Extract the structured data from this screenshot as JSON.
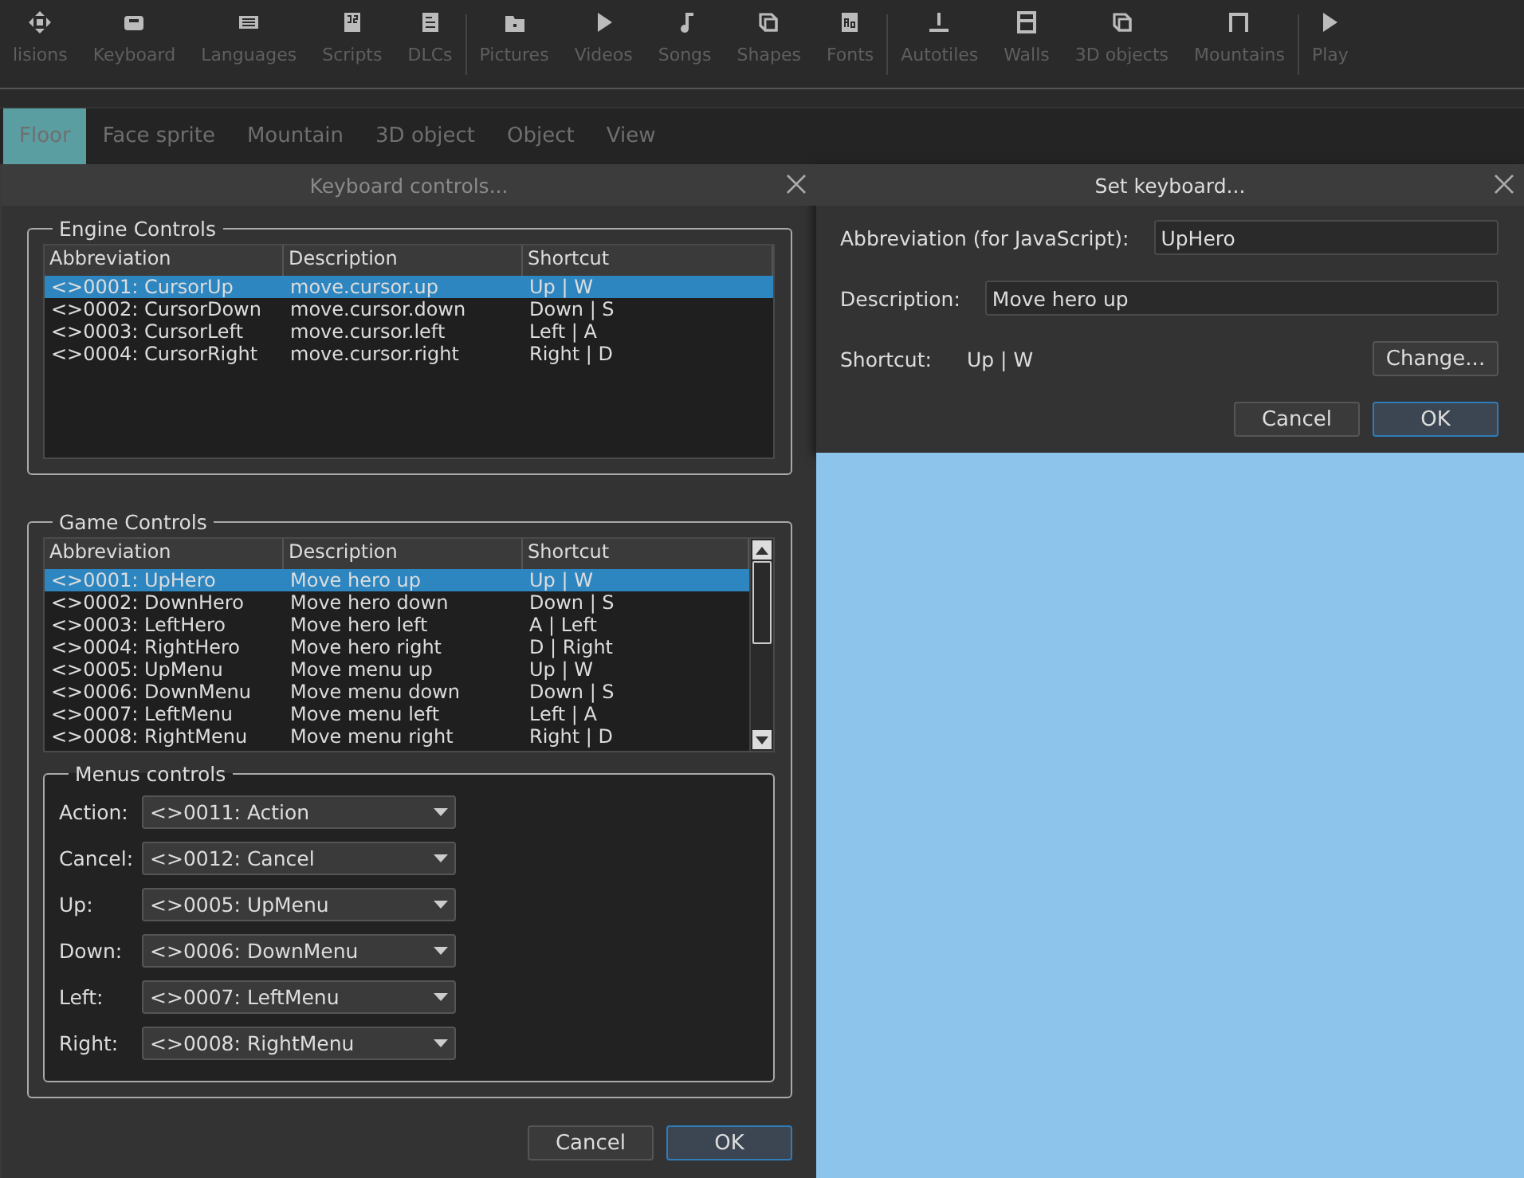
{
  "toolbar": {
    "groups": [
      {
        "items": [
          {
            "label": "lisions",
            "kind": "move"
          },
          {
            "label": "Keyboard",
            "kind": "keyboard"
          },
          {
            "label": "Languages",
            "kind": "flag"
          },
          {
            "label": "Scripts",
            "kind": "script"
          },
          {
            "label": "DLCs",
            "kind": "document"
          }
        ]
      },
      {
        "items": [
          {
            "label": "Pictures",
            "kind": "folder"
          },
          {
            "label": "Videos",
            "kind": "play"
          },
          {
            "label": "Songs",
            "kind": "note"
          },
          {
            "label": "Shapes",
            "kind": "cube"
          },
          {
            "label": "Fonts",
            "kind": "font"
          }
        ]
      },
      {
        "items": [
          {
            "label": "Autotiles",
            "kind": "autotile"
          },
          {
            "label": "Walls",
            "kind": "wall"
          },
          {
            "label": "3D objects",
            "kind": "cube"
          },
          {
            "label": "Mountains",
            "kind": "mountain"
          }
        ]
      },
      {
        "items": [
          {
            "label": "Play",
            "kind": "play"
          }
        ]
      }
    ]
  },
  "tabs": [
    {
      "label": "Floor",
      "selected": true
    },
    {
      "label": "Face sprite",
      "selected": false
    },
    {
      "label": "Mountain",
      "selected": false
    },
    {
      "label": "3D object",
      "selected": false
    },
    {
      "label": "Object",
      "selected": false
    },
    {
      "label": "View",
      "selected": false
    }
  ],
  "keyboard_dialog": {
    "title": "Keyboard controls...",
    "engine_controls": {
      "title": "Engine Controls",
      "columns": [
        "Abbreviation",
        "Description",
        "Shortcut"
      ],
      "rows": [
        {
          "cells": [
            "<>0001: CursorUp",
            "move.cursor.up",
            "Up | W"
          ],
          "selected": true
        },
        {
          "cells": [
            "<>0002: CursorDown",
            "move.cursor.down",
            "Down | S"
          ],
          "selected": false
        },
        {
          "cells": [
            "<>0003: CursorLeft",
            "move.cursor.left",
            "Left | A"
          ],
          "selected": false
        },
        {
          "cells": [
            "<>0004: CursorRight",
            "move.cursor.right",
            "Right | D"
          ],
          "selected": false
        }
      ]
    },
    "game_controls": {
      "title": "Game Controls",
      "columns": [
        "Abbreviation",
        "Description",
        "Shortcut"
      ],
      "rows": [
        {
          "cells": [
            "<>0001: UpHero",
            "Move hero up",
            "Up | W"
          ],
          "selected": true
        },
        {
          "cells": [
            "<>0002: DownHero",
            "Move hero down",
            "Down | S"
          ],
          "selected": false
        },
        {
          "cells": [
            "<>0003: LeftHero",
            "Move hero left",
            "A | Left"
          ],
          "selected": false
        },
        {
          "cells": [
            "<>0004: RightHero",
            "Move hero right",
            "D | Right"
          ],
          "selected": false
        },
        {
          "cells": [
            "<>0005: UpMenu",
            "Move menu up",
            "Up | W"
          ],
          "selected": false
        },
        {
          "cells": [
            "<>0006: DownMenu",
            "Move menu down",
            "Down | S"
          ],
          "selected": false
        },
        {
          "cells": [
            "<>0007: LeftMenu",
            "Move menu left",
            "Left | A"
          ],
          "selected": false
        },
        {
          "cells": [
            "<>0008: RightMenu",
            "Move menu right",
            "Right | D"
          ],
          "selected": false
        }
      ]
    },
    "menus_controls": {
      "title": "Menus controls",
      "rows": [
        {
          "label": "Action:",
          "value": "<>0011: Action"
        },
        {
          "label": "Cancel:",
          "value": "<>0012: Cancel"
        },
        {
          "label": "Up:",
          "value": "<>0005: UpMenu"
        },
        {
          "label": "Down:",
          "value": "<>0006: DownMenu"
        },
        {
          "label": "Left:",
          "value": "<>0007: LeftMenu"
        },
        {
          "label": "Right:",
          "value": "<>0008: RightMenu"
        }
      ]
    },
    "buttons": [
      {
        "label": "Cancel",
        "default": false
      },
      {
        "label": "OK",
        "default": true
      }
    ]
  },
  "set_keyboard_dialog": {
    "title": "Set keyboard...",
    "fields": [
      {
        "label": "Abbreviation (for JavaScript):",
        "value": "UpHero"
      },
      {
        "label": "Description:",
        "value": "Move hero up"
      }
    ],
    "shortcut": {
      "label": "Shortcut:",
      "value": "Up | W",
      "button": "Change..."
    },
    "buttons": [
      {
        "label": "Cancel",
        "default": false
      },
      {
        "label": "OK",
        "default": true
      }
    ]
  }
}
